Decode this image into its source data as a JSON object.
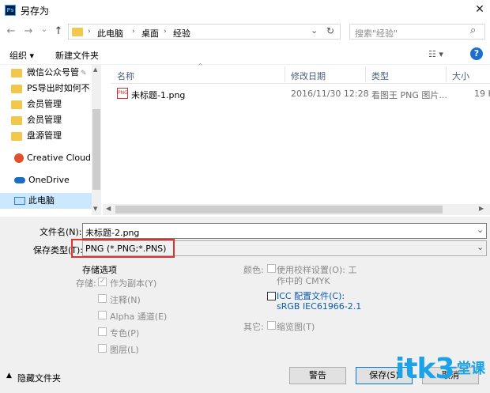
{
  "window": {
    "title": "另存为",
    "app_icon": "Ps",
    "close": "✕"
  },
  "nav": {
    "back": "←",
    "forward": "→",
    "dropdown": "⌄",
    "up": "↑",
    "breadcrumbs": [
      "此电脑",
      "桌面",
      "经验"
    ],
    "crumb_sep": "›",
    "addr_dropdown": "⌄",
    "refresh": "↻",
    "search_placeholder": "搜索\"经验\"",
    "search_icon": "⌕"
  },
  "toolbar": {
    "organize": "组织 ▾",
    "new_folder": "新建文件夹",
    "view": "☷ ▾",
    "help": "?"
  },
  "sidebar": {
    "items": [
      {
        "label": "微信公众号管"
      },
      {
        "label": "PS导出时如何不"
      },
      {
        "label": "会员管理"
      },
      {
        "label": "会员管理"
      },
      {
        "label": "盘源管理"
      },
      {
        "label": "Creative Cloud F"
      },
      {
        "label": "OneDrive"
      },
      {
        "label": "此电脑"
      }
    ]
  },
  "file_list": {
    "columns": [
      "名称",
      "修改日期",
      "类型",
      "大小"
    ],
    "rows": [
      {
        "name": "未标题-1.png",
        "date": "2016/11/30 12:28",
        "type": "看图王 PNG 图片...",
        "size": "19 K"
      }
    ]
  },
  "form": {
    "filename_label": "文件名(N):",
    "filename_value": "未标题-2.png",
    "filetype_label": "保存类型(T):",
    "filetype_value": "PNG (*.PNG;*.PNS)"
  },
  "options": {
    "section_title": "存储选项",
    "store_label": "存储:",
    "as_copy": "作为副本(Y)",
    "notes": "注释(N)",
    "alpha": "Alpha 通道(E)",
    "spot": "专色(P)",
    "layers": "图层(L)",
    "color_label": "颜色:",
    "proof": "使用校样设置(O): 工",
    "proof2": "作中的 CMYK",
    "icc": "ICC 配置文件(C):",
    "icc2": "sRGB IEC61966-2.1",
    "other_label": "其它:",
    "thumbnail": "缩览图(T)"
  },
  "footer": {
    "hide_folders": "隐藏文件夹",
    "warning_btn": "警告",
    "save_btn": "保存(S)",
    "cancel_btn": "取消"
  },
  "watermark": {
    "main": "itk3",
    "sub": "一堂课"
  }
}
